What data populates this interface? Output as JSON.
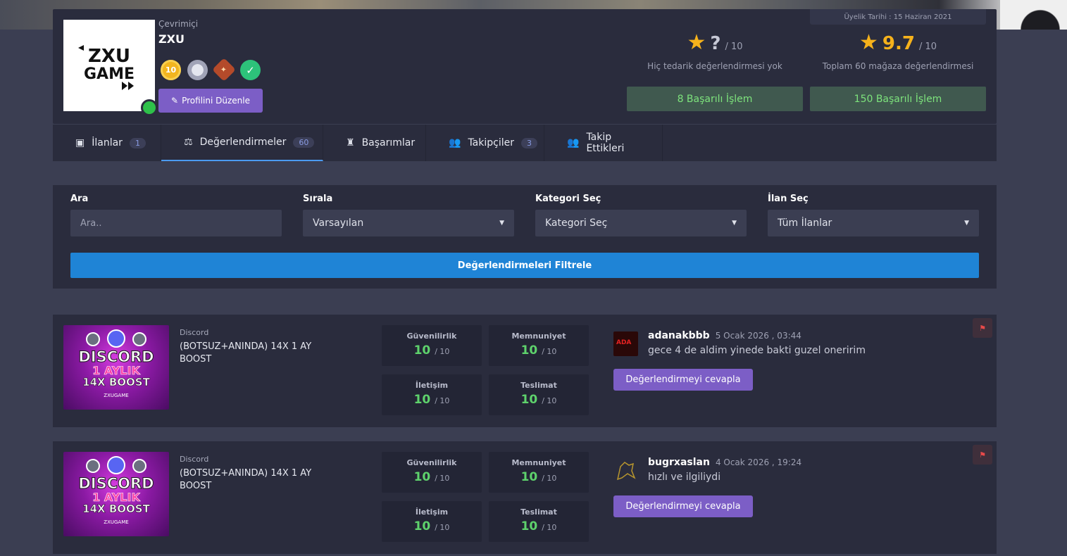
{
  "profile": {
    "status": "Çevrimiçi",
    "username": "ZXU",
    "logo_text_line1": "ZXU",
    "logo_text_line2": "GAME",
    "level_badge": "10",
    "edit_button": "Profilini Düzenle",
    "member_since": "Üyelik Tarihi : 15 Haziran 2021",
    "supply_rating": {
      "score": "?",
      "of": "/ 10",
      "caption": "Hiç tedarik değerlendirmesi yok",
      "success": "8 Başarılı İşlem"
    },
    "store_rating": {
      "score": "9.7",
      "of": "/ 10",
      "caption": "Toplam 60 mağaza değerlendirmesi",
      "success": "150 Başarılı İşlem"
    },
    "colors": {
      "accent_purple": "#7c5ec6",
      "rating_gold": "#f6b21b",
      "success_green": "#7de37c",
      "score_green": "#5ed26c",
      "filter_blue": "#1f84d6"
    }
  },
  "tabs": [
    {
      "label": "İlanlar",
      "count": "1",
      "icon": "box-icon"
    },
    {
      "label": "Değerlendirmeler",
      "count": "60",
      "icon": "scale-icon"
    },
    {
      "label": "Başarımlar",
      "count": "",
      "icon": "trophy-icon"
    },
    {
      "label": "Takipçiler",
      "count": "3",
      "icon": "users-icon"
    },
    {
      "label": "Takip Ettikleri",
      "count": "",
      "icon": "users-icon"
    }
  ],
  "filters": {
    "search": {
      "label": "Ara",
      "placeholder": "Ara.."
    },
    "sort": {
      "label": "Sırala",
      "value": "Varsayılan"
    },
    "category": {
      "label": "Kategori Seç",
      "value": "Kategori Seç"
    },
    "listing": {
      "label": "İlan Seç",
      "value": "Tüm İlanlar"
    },
    "button": "Değerlendirmeleri Filtrele"
  },
  "reviews": [
    {
      "category": "Discord",
      "title": "(BOTSUZ+ANINDA) 14X 1 AY BOOST",
      "image_lines": [
        "DISCORD",
        "1 AYLIK",
        "14X BOOST",
        "ZXUGAME"
      ],
      "scores": [
        {
          "label": "Güvenilirlik",
          "value": "10",
          "of": "/ 10"
        },
        {
          "label": "Memnuniyet",
          "value": "10",
          "of": "/ 10"
        },
        {
          "label": "İletişim",
          "value": "10",
          "of": "/ 10"
        },
        {
          "label": "Teslimat",
          "value": "10",
          "of": "/ 10"
        }
      ],
      "reviewer": "adanakbbb",
      "date": "5 Ocak 2026 , 03:44",
      "comment": "gece 4 de aldim yinede bakti guzel oneririm",
      "reply_button": "Değerlendirmeyi cevapla"
    },
    {
      "category": "Discord",
      "title": "(BOTSUZ+ANINDA) 14X 1 AY BOOST",
      "image_lines": [
        "DISCORD",
        "1 AYLIK",
        "14X BOOST",
        "ZXUGAME"
      ],
      "scores": [
        {
          "label": "Güvenilirlik",
          "value": "10",
          "of": "/ 10"
        },
        {
          "label": "Memnuniyet",
          "value": "10",
          "of": "/ 10"
        },
        {
          "label": "İletişim",
          "value": "10",
          "of": "/ 10"
        },
        {
          "label": "Teslimat",
          "value": "10",
          "of": "/ 10"
        }
      ],
      "reviewer": "bugrxaslan",
      "date": "4 Ocak 2026 , 19:24",
      "comment": "hızlı ve ilgiliydi",
      "reply_button": "Değerlendirmeyi cevapla"
    }
  ]
}
